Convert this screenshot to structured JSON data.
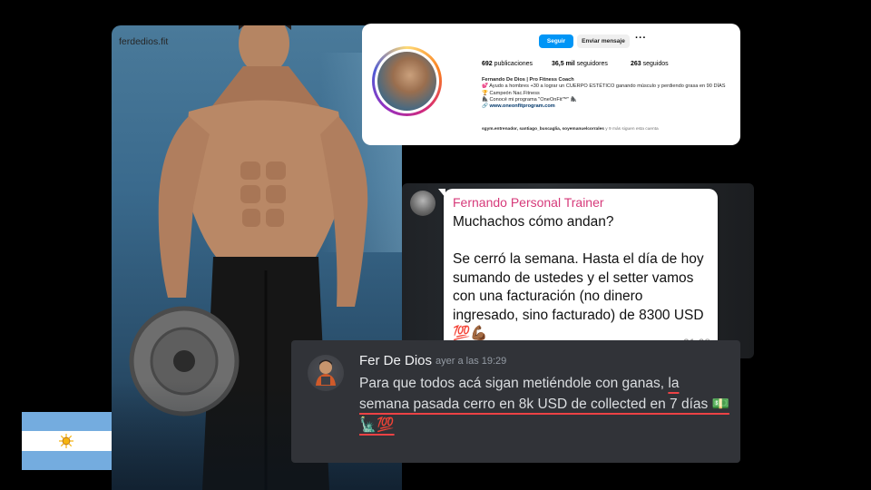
{
  "instagram": {
    "username": "ferdedios.fit",
    "follow_label": "Seguir",
    "message_label": "Enviar mensaje",
    "more_icon": "···",
    "stats": [
      {
        "value": "692",
        "label": "publicaciones"
      },
      {
        "value": "36,5 mil",
        "label": "seguidores"
      },
      {
        "value": "263",
        "label": "seguidos"
      }
    ],
    "bio": {
      "name": "Fernando De Dios | Pro Fitness Coach",
      "line1": "💕 Ayudo a hombres +30 a lograr un CUERPO ESTÉTICO ganando músculo y perdiendo grasa en 90 DÍAS",
      "line2": "🏆 Campeón Nac.Fitness",
      "line3": "🦍 Conocé mi programa \"OneOnFit™\" 🦍",
      "link": "🔗 www.oneonfitprogram.com"
    },
    "followed_by_names": "sgym.entrenador, santiago_buscaglia, soyemanuelcorrales",
    "followed_by_more": " y 9 más siguen esta cuenta",
    "accent_color": "#0095f6"
  },
  "whatsapp": {
    "sender": "Fernando Personal Trainer",
    "message": "Muchachos cómo andan?\n\nSe cerró la semana. Hasta el día de hoy sumando de ustedes y el setter vamos con una facturación (no dinero ingresado, sino facturado) de 8300 USD 💯💪🏾",
    "time": "21:28",
    "sender_color": "#d63a7a"
  },
  "discord": {
    "name": "Fer De Dios",
    "timestamp": "ayer a las 19:29",
    "text_plain": "Para que todos acá sigan metiéndole con ganas, ",
    "text_underlined": "la semana pasada cerro en 8k USD de collected en 7 días 💵🗽💯",
    "underline_color": "#ed4245"
  },
  "flag": {
    "name": "argentina-flag",
    "colors": {
      "blue": "#74acdf",
      "white": "#ffffff",
      "sun": "#f6b40e"
    }
  }
}
